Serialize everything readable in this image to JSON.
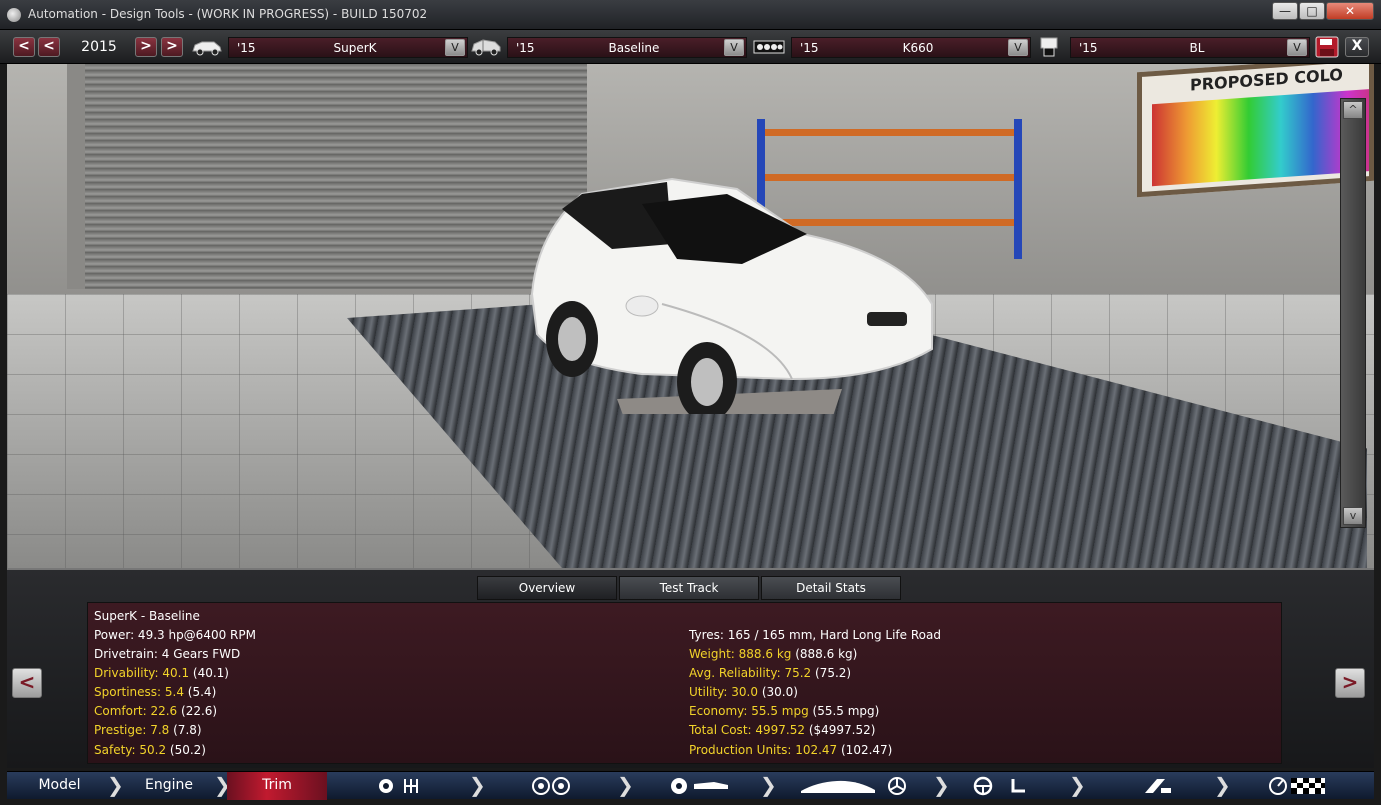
{
  "window": {
    "title": "Automation - Design Tools - (WORK IN PROGRESS) - BUILD 150702",
    "min": "—",
    "max": "□",
    "close": "✕"
  },
  "toolbar": {
    "prev2": "<",
    "prev": "<",
    "year": "2015",
    "next": ">",
    "next2": ">",
    "model": {
      "year": "'15",
      "name": "SuperK"
    },
    "trim": {
      "year": "'15",
      "name": "Baseline"
    },
    "engine": {
      "year": "'15",
      "name": "K660"
    },
    "variant": {
      "year": "'15",
      "name": "BL"
    },
    "dropdown": "V",
    "save_icon": "floppy-disk-icon",
    "close_label": "X"
  },
  "viewport": {
    "board_title": "PROPOSED COLO",
    "scroll_up": "^",
    "scroll_down": "v"
  },
  "panel": {
    "tabs": [
      "Overview",
      "Test Track",
      "Detail Stats"
    ],
    "prev": "<",
    "next": ">",
    "heading": "SuperK - Baseline",
    "left": [
      {
        "label": "Power: 49.3 hp@6400 RPM",
        "value": ""
      },
      {
        "label": "Drivetrain: 4 Gears FWD",
        "value": ""
      },
      {
        "label": "Drivability: 40.1",
        "value": " (40.1)"
      },
      {
        "label": "Sportiness: 5.4",
        "value": " (5.4)"
      },
      {
        "label": "Comfort: 22.6",
        "value": " (22.6)"
      },
      {
        "label": "Prestige: 7.8",
        "value": " (7.8)"
      },
      {
        "label": "Safety: 50.2",
        "value": " (50.2)"
      }
    ],
    "right": [
      {
        "label": "Tyres: 165 / 165 mm, Hard Long Life Road",
        "value": ""
      },
      {
        "label": "Weight: 888.6 kg",
        "value": " (888.6 kg)"
      },
      {
        "label": "Avg. Reliability: 75.2",
        "value": " (75.2)"
      },
      {
        "label": "Utility: 30.0",
        "value": " (30.0)"
      },
      {
        "label": "Economy: 55.5 mpg",
        "value": " (55.5 mpg)"
      },
      {
        "label": "Total Cost: 4997.52",
        "value": " ($4997.52)"
      },
      {
        "label": "Production Units: 102.47",
        "value": " (102.47)"
      }
    ]
  },
  "bottombar": {
    "tabs": [
      "Model",
      "Engine",
      "Trim"
    ]
  },
  "colors": {
    "accent": "#c11a2f",
    "highlight": "#f2d32a",
    "panel": "#3d1a22"
  }
}
